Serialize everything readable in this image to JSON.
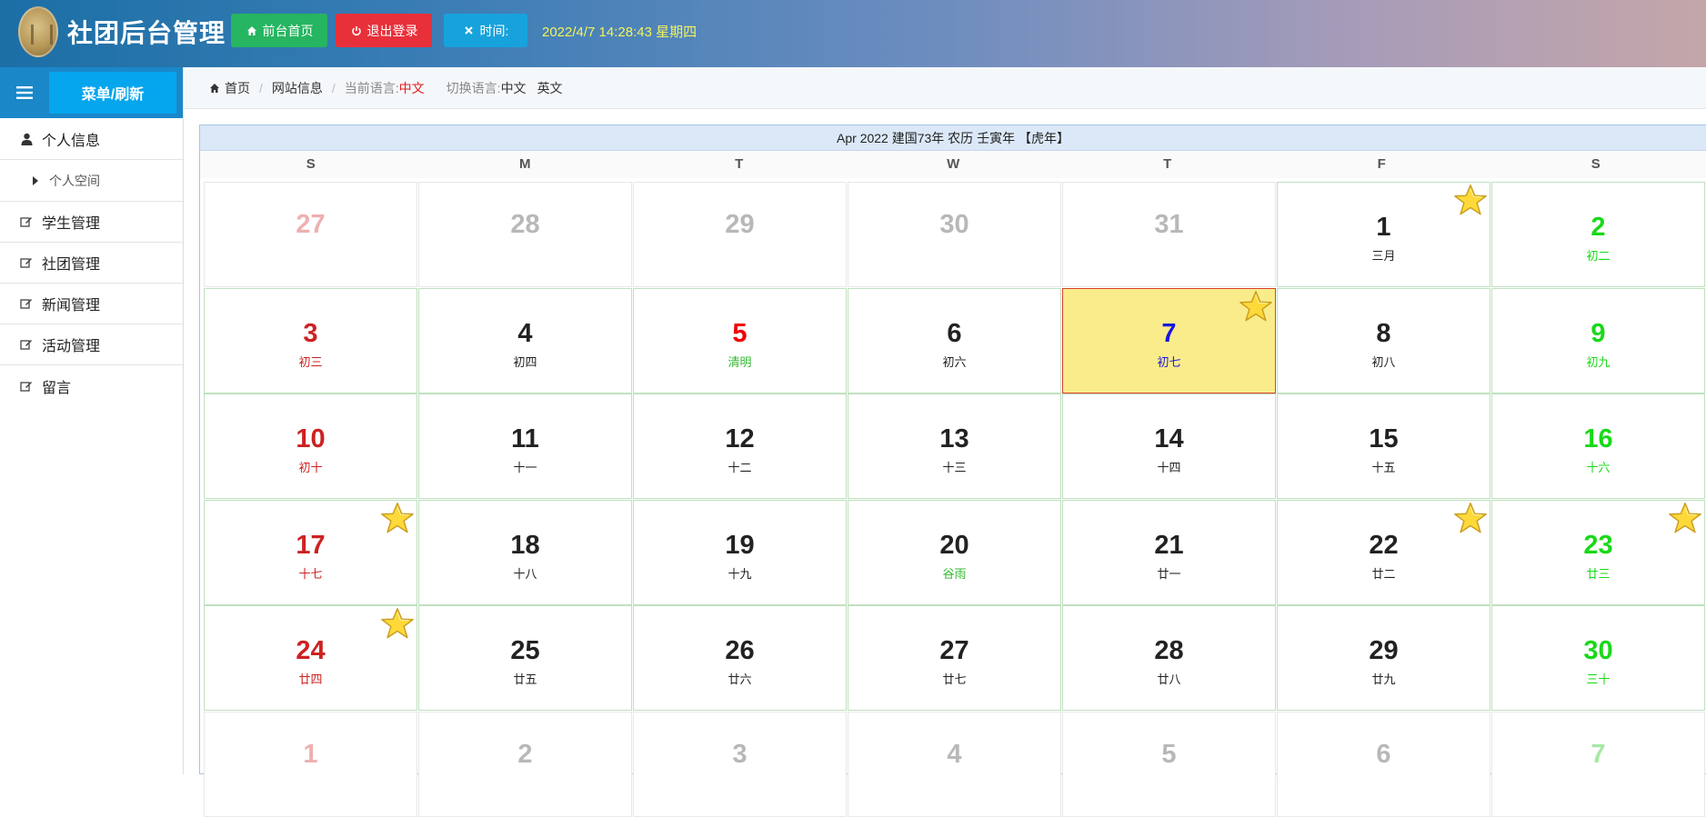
{
  "header": {
    "app_title": "社团后台管理",
    "home_button": "前台首页",
    "logout_button": "退出登录",
    "time_button": "时间:",
    "datetime": "2022/4/7 14:28:43 星期四"
  },
  "sidebar": {
    "menu_refresh": "菜单/刷新",
    "items": [
      {
        "label": "个人信息",
        "icon": "user-icon"
      },
      {
        "label": "个人空间",
        "icon": "caret-right-icon"
      },
      {
        "label": "学生管理",
        "icon": "edit-icon"
      },
      {
        "label": "社团管理",
        "icon": "edit-icon"
      },
      {
        "label": "新闻管理",
        "icon": "edit-icon"
      },
      {
        "label": "活动管理",
        "icon": "edit-icon"
      },
      {
        "label": "留言",
        "icon": "edit-icon"
      }
    ]
  },
  "breadcrumb": {
    "home": "首页",
    "page": "网站信息",
    "current_lang_label": "当前语言:",
    "current_lang": "中文",
    "switch_lang_label": "切换语言:",
    "lang_zh": "中文",
    "lang_en": "英文"
  },
  "calendar": {
    "title": "Apr 2022 建国73年 农历 壬寅年 【虎年】",
    "weekdays": [
      "S",
      "M",
      "T",
      "W",
      "T",
      "F",
      "S"
    ],
    "colors": {
      "today_bg": "#fbec8b",
      "today_border": "#d93f2a",
      "weekend_sun": "#cc2222",
      "weekend_sat": "#18d918"
    },
    "days": [
      {
        "n": "27",
        "l": "",
        "cls": "c-pink",
        "out": true
      },
      {
        "n": "28",
        "l": "",
        "cls": "c-gray",
        "out": true
      },
      {
        "n": "29",
        "l": "",
        "cls": "c-gray",
        "out": true
      },
      {
        "n": "30",
        "l": "",
        "cls": "c-gray",
        "out": true
      },
      {
        "n": "31",
        "l": "",
        "cls": "c-gray",
        "out": true
      },
      {
        "n": "1",
        "l": "三月",
        "cls": "c-black",
        "lcls": "c-black",
        "star": true
      },
      {
        "n": "2",
        "l": "初二",
        "cls": "c-green",
        "lcls": "c-green"
      },
      {
        "n": "3",
        "l": "初三",
        "cls": "c-red",
        "lcls": "c-red"
      },
      {
        "n": "4",
        "l": "初四",
        "cls": "c-black",
        "lcls": "c-black"
      },
      {
        "n": "5",
        "l": "清明",
        "cls": "c-red2",
        "lcls": "c-termgreen"
      },
      {
        "n": "6",
        "l": "初六",
        "cls": "c-black",
        "lcls": "c-black"
      },
      {
        "n": "7",
        "l": "初七",
        "cls": "c-blue",
        "lcls": "c-blue",
        "today": true,
        "star": true
      },
      {
        "n": "8",
        "l": "初八",
        "cls": "c-black",
        "lcls": "c-black"
      },
      {
        "n": "9",
        "l": "初九",
        "cls": "c-green",
        "lcls": "c-green"
      },
      {
        "n": "10",
        "l": "初十",
        "cls": "c-red",
        "lcls": "c-red"
      },
      {
        "n": "11",
        "l": "十一",
        "cls": "c-black",
        "lcls": "c-black"
      },
      {
        "n": "12",
        "l": "十二",
        "cls": "c-black",
        "lcls": "c-black"
      },
      {
        "n": "13",
        "l": "十三",
        "cls": "c-black",
        "lcls": "c-black"
      },
      {
        "n": "14",
        "l": "十四",
        "cls": "c-black",
        "lcls": "c-black"
      },
      {
        "n": "15",
        "l": "十五",
        "cls": "c-black",
        "lcls": "c-black"
      },
      {
        "n": "16",
        "l": "十六",
        "cls": "c-green",
        "lcls": "c-green"
      },
      {
        "n": "17",
        "l": "十七",
        "cls": "c-red",
        "lcls": "c-red",
        "star": true
      },
      {
        "n": "18",
        "l": "十八",
        "cls": "c-black",
        "lcls": "c-black"
      },
      {
        "n": "19",
        "l": "十九",
        "cls": "c-black",
        "lcls": "c-black"
      },
      {
        "n": "20",
        "l": "谷雨",
        "cls": "c-black",
        "lcls": "c-termgreen"
      },
      {
        "n": "21",
        "l": "廿一",
        "cls": "c-black",
        "lcls": "c-black"
      },
      {
        "n": "22",
        "l": "廿二",
        "cls": "c-black",
        "lcls": "c-black",
        "star": true
      },
      {
        "n": "23",
        "l": "廿三",
        "cls": "c-green",
        "lcls": "c-green",
        "star": true
      },
      {
        "n": "24",
        "l": "廿四",
        "cls": "c-red",
        "lcls": "c-red",
        "star": true
      },
      {
        "n": "25",
        "l": "廿五",
        "cls": "c-black",
        "lcls": "c-black"
      },
      {
        "n": "26",
        "l": "廿六",
        "cls": "c-black",
        "lcls": "c-black"
      },
      {
        "n": "27",
        "l": "廿七",
        "cls": "c-black",
        "lcls": "c-black"
      },
      {
        "n": "28",
        "l": "廿八",
        "cls": "c-black",
        "lcls": "c-black"
      },
      {
        "n": "29",
        "l": "廿九",
        "cls": "c-black",
        "lcls": "c-black"
      },
      {
        "n": "30",
        "l": "三十",
        "cls": "c-green",
        "lcls": "c-green"
      },
      {
        "n": "1",
        "l": "",
        "cls": "c-pink",
        "out": true
      },
      {
        "n": "2",
        "l": "",
        "cls": "c-gray",
        "out": true
      },
      {
        "n": "3",
        "l": "",
        "cls": "c-gray",
        "out": true
      },
      {
        "n": "4",
        "l": "",
        "cls": "c-gray",
        "out": true
      },
      {
        "n": "5",
        "l": "",
        "cls": "c-gray",
        "out": true
      },
      {
        "n": "6",
        "l": "",
        "cls": "c-gray",
        "out": true
      },
      {
        "n": "7",
        "l": "",
        "cls": "c-lgreen",
        "out": true
      }
    ]
  }
}
